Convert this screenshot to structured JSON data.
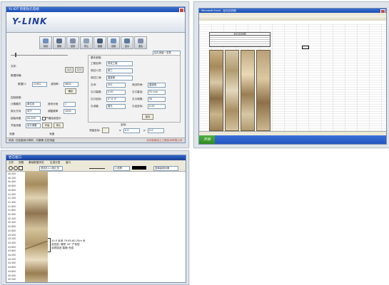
{
  "screen1": {
    "title": "YL-IDT 智能钻孔电视",
    "logo": "Y-LINK",
    "toolbar": [
      "帧设",
      "摄像",
      "回放",
      "停止",
      "截图",
      "设置",
      "显示",
      "退出"
    ],
    "dropdown_right": "钻孔测量一览表",
    "left": {
      "file_label": "文件:",
      "sect1": "数据传输:",
      "speed_label": "数据口:",
      "speed_val": "COM1",
      "baud_label": "波特率:",
      "baud_val": "9600",
      "ok_label": "确定",
      "sect2": "控制参数:",
      "r1a": "计数模式",
      "r1a_val": "单位米",
      "r1b": "按米分段",
      "r1b_val": "1",
      "r2a": "探头方向",
      "r2a_val": "向下",
      "r2b": "调整频率",
      "r2b_val": "1000",
      "r3a": "起始深度",
      "r3a_val": "00.000",
      "r3b": "严格连续显示",
      "r4a": "开始深度",
      "r4a_val": "自行调整",
      "start": "开始",
      "stop": "停止"
    },
    "right": {
      "sect": "基本参数:",
      "fields": [
        {
          "l": "工程名称:",
          "v": "测试工程"
        },
        {
          "l": "测试人员:",
          "v": "张三"
        },
        {
          "l": "测试工地:",
          "v": "直接测"
        },
        {
          "l": "孔号:",
          "v": "ZK1",
          "l2": "测试时间:",
          "v2": "直接测"
        },
        {
          "l": "孔口高程:",
          "v": "0.00",
          "l2": "孔口直径:",
          "v2": "91 mm"
        },
        {
          "l": "孔口坐标:",
          "v": "0° 0' 0\"",
          "l2": "孔口倾角:",
          "v2": "90"
        },
        {
          "l": "孔深度:",
          "v": "直孔",
          "l2": "孔径坐标:",
          "v2": "0.00"
        }
      ],
      "save": "保存",
      "sect3": "坐标:",
      "coord_label": "测量坐标:",
      "x": "0.0",
      "y": "0.0"
    },
    "footer_a": "深度:",
    "footer_b": "深度",
    "status_left": "状态: 已连接到计算机，可摄像·正在测量",
    "status_right": "北京智能岩土工程技术有限公司"
  },
  "screen2": {
    "title": "Microsoft Excel - 钻孔柱状图",
    "sheet_title": "钻孔柱状图",
    "start": "开始"
  },
  "screen3": {
    "title": "岩芯窗口",
    "menu": [
      "文件",
      "视图",
      "基础数据浏览",
      "生成分层",
      "窗口"
    ],
    "page_sel": "测试孔1-1张汇总",
    "line_sel": "1 倍率",
    "palette_sel": "选择绘制对象",
    "depths": [
      "40.000",
      "40.200",
      "40.400",
      "40.600",
      "40.800",
      "41.000",
      "41.200",
      "41.400",
      "41.600",
      "41.800",
      "42.000",
      "42.200",
      "42.400",
      "42.600",
      "42.800",
      "43.000",
      "43.200",
      "43.400",
      "43.600",
      "43.800",
      "44.000",
      "44.200",
      "44.400",
      "44.600",
      "44.800",
      "45.000",
      "45.200"
    ],
    "annot": [
      "20.0 米深 79.85-60.20m 米",
      "岩性层: 硬质 50° 产状层",
      "泥质描述 裂隙 完成"
    ]
  },
  "colors": {
    "titlebar": "#1d4fb3",
    "panel": "#dfe4ea",
    "window": "#ece9d8",
    "excel_start": "#3a8d2c"
  }
}
